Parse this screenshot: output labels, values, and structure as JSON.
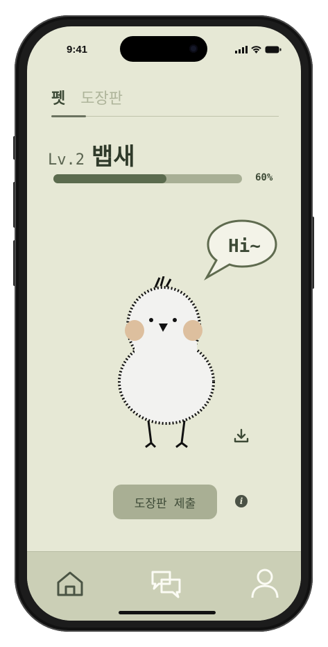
{
  "status": {
    "time": "9:41"
  },
  "tabs": [
    {
      "label": "펫",
      "active": true
    },
    {
      "label": "도장판",
      "active": false
    }
  ],
  "pet": {
    "level": "Lv.2",
    "name": "뱁새",
    "progress_label": "60%",
    "progress": 0.6,
    "speech": "Hi~"
  },
  "actions": {
    "submit_label": "도장판 제출",
    "info_symbol": "i"
  },
  "nav": [
    "home-icon",
    "chat-icon",
    "profile-icon"
  ],
  "colors": {
    "background": "#e6e8d5",
    "accent": "#5b6b4e",
    "nav": "#cbcfb6"
  }
}
